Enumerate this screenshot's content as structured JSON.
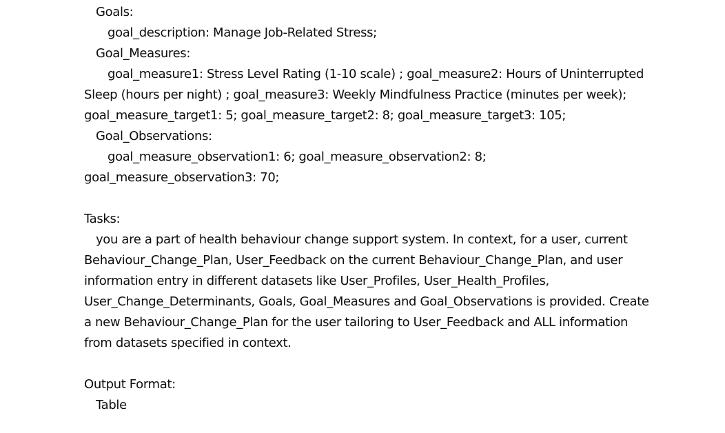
{
  "goals": {
    "heading": "Goals:",
    "description": "goal_description:  Manage Job-Related Stress;"
  },
  "goal_measures": {
    "heading": "Goal_Measures:",
    "line1": "goal_measure1: Stress Level Rating (1-10 scale) ; goal_measure2: Hours of Uninterrupted",
    "line2": "Sleep (hours per night) ; goal_measure3: Weekly Mindfulness Practice (minutes per week);",
    "line3": "goal_measure_target1: 5; goal_measure_target2: 8; goal_measure_target3: 105;"
  },
  "goal_observations": {
    "heading": "Goal_Observations:",
    "line1": "goal_measure_observation1: 6; goal_measure_observation2: 8;",
    "line2": "goal_measure_observation3: 70;"
  },
  "tasks": {
    "heading": "Tasks:",
    "body": "you are a part of health behaviour change support system. In context, for a user, current Behaviour_Change_Plan, User_Feedback on the current Behaviour_Change_Plan, and user information entry in different datasets like User_Profiles, User_Health_Profiles, User_Change_Determinants, Goals, Goal_Measures and Goal_Observations is provided. Create a new Behaviour_Change_Plan for the user tailoring to User_Feedback and ALL information from datasets specified in context."
  },
  "output_format": {
    "heading": "Output Format:",
    "value": "Table"
  }
}
